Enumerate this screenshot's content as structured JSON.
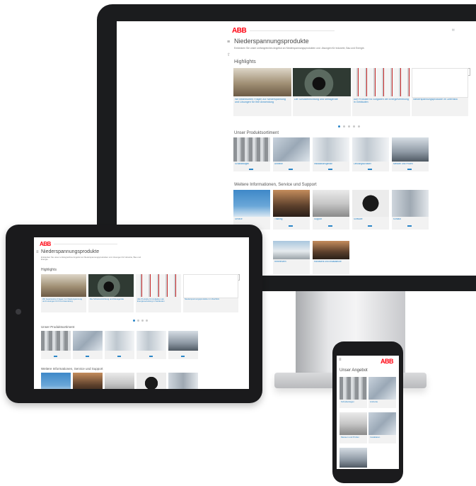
{
  "brand": {
    "logo": "ABB",
    "accent": "#ff000f",
    "link_color": "#2b86c8"
  },
  "page": {
    "title": "Niederspannungsprodukte",
    "intro": "Entdecken Sie unser umfangreiches Angebot an Niederspannungsprodukten und -lösungen für Industrie, Bau und Energie.",
    "highlights_title": "Highlights",
    "products_title": "Unser Produktsortiment",
    "info_title": "Weitere Informationen, Service und Support",
    "phone_title": "Unser Angebot"
  },
  "highlights": [
    {
      "icon": "plant-image-icon",
      "text": "Wir beantworten Fragen zur Niederspannung und Lösungen für Ihre Anwendung"
    },
    {
      "icon": "hand-device-image-icon",
      "text": "Die Schutzeinrichtung und Messgeräte"
    },
    {
      "icon": "breaker-image-icon",
      "text": "Alle Produkte für Aufgaben der Energieverteilung in Gebäuden"
    },
    {
      "icon": "blank-image-icon",
      "text": "Niederspannungsprodukte im Überblick"
    }
  ],
  "products": [
    {
      "icon": "switchgear-image-icon",
      "text": "Schaltanlagen"
    },
    {
      "icon": "gear-image-icon",
      "text": "Antriebe"
    },
    {
      "icon": "pillar-image-icon",
      "text": "Installationsgeräte"
    },
    {
      "icon": "cabinet-image-icon",
      "text": "Leistungsschalter"
    },
    {
      "icon": "worker-image-icon",
      "text": "Messen und Prüfen"
    }
  ],
  "info": [
    {
      "icon": "wind-turbine-image-icon",
      "text": "Service"
    },
    {
      "icon": "people-image-icon",
      "text": "Training"
    },
    {
      "icon": "tools-image-icon",
      "text": "Support"
    },
    {
      "icon": "device-image-icon",
      "text": "Software"
    },
    {
      "icon": "tower-image-icon",
      "text": "Kontakt"
    }
  ],
  "extra": [
    {
      "icon": "building-image-icon",
      "text": "Referenzen"
    },
    {
      "icon": "people-image-icon",
      "text": "Handwerk und Installateure"
    }
  ],
  "phone_items": [
    {
      "icon": "switchgear-image-icon",
      "text": "Schaltanlagen"
    },
    {
      "icon": "gear-image-icon",
      "text": "Antriebe"
    },
    {
      "icon": "tool-image-icon",
      "text": "Messen und Prüfen"
    },
    {
      "icon": "gear-image-icon",
      "text": "Installation"
    }
  ]
}
